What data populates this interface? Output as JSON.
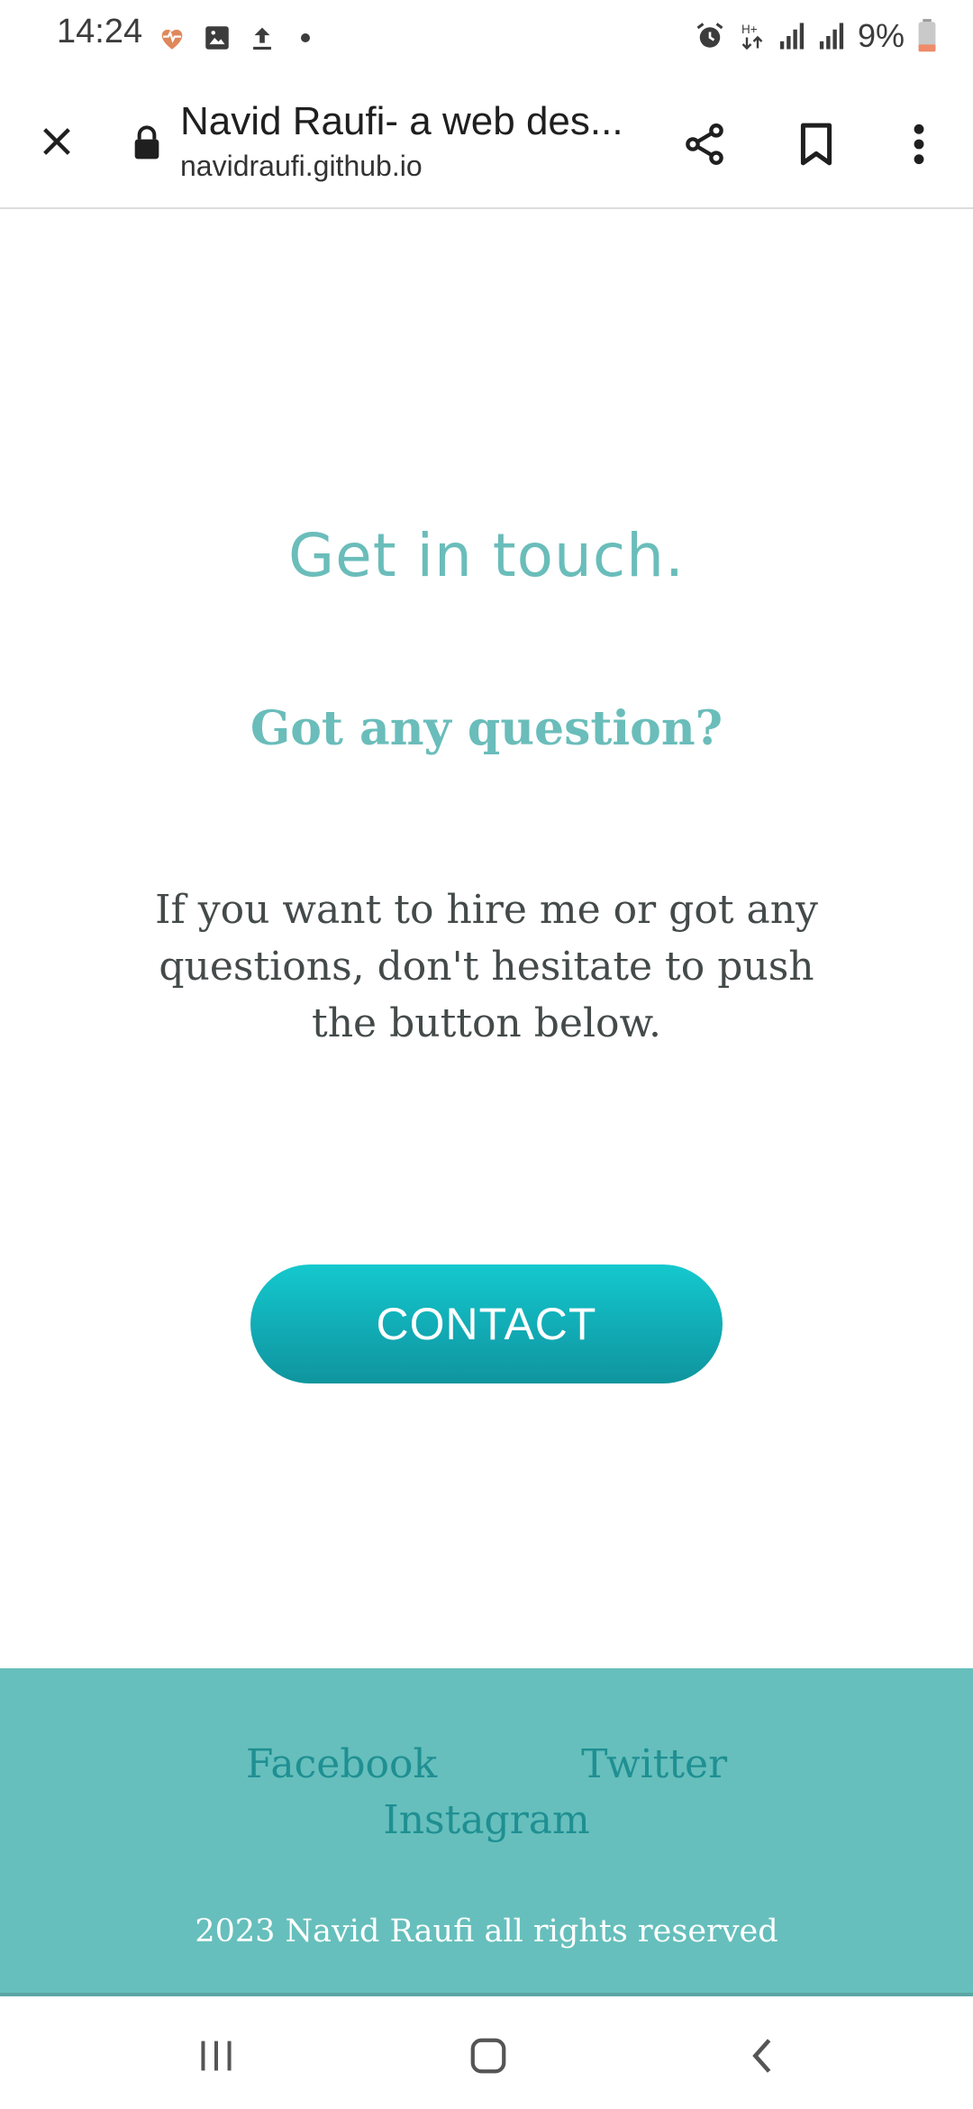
{
  "status_bar": {
    "time": "14:24",
    "battery": "9%",
    "icons_left": [
      "health-heart-icon",
      "gallery-icon",
      "upload-icon",
      "notification-dot"
    ],
    "icons_right": [
      "alarm-icon",
      "data-arrows-icon",
      "signal-icon",
      "signal-icon",
      "battery-icon"
    ]
  },
  "browser": {
    "title": "Navid Raufi- a web des...",
    "url": "navidraufi.github.io"
  },
  "page": {
    "heading": "Get in touch.",
    "subheading": "Got any question?",
    "paragraph": "If you want to hire me or got any questions, don't hesitate to push the button below.",
    "contact_button": "CONTACT"
  },
  "footer": {
    "links": [
      "Facebook",
      "Twitter",
      "Instagram"
    ],
    "copyright": "2023 Navid Raufi all rights reserved"
  },
  "colors": {
    "accent": "#6abdba",
    "button": "#14b8c0",
    "footer_bg": "#66bfbc",
    "footer_link": "#1f8f92"
  }
}
